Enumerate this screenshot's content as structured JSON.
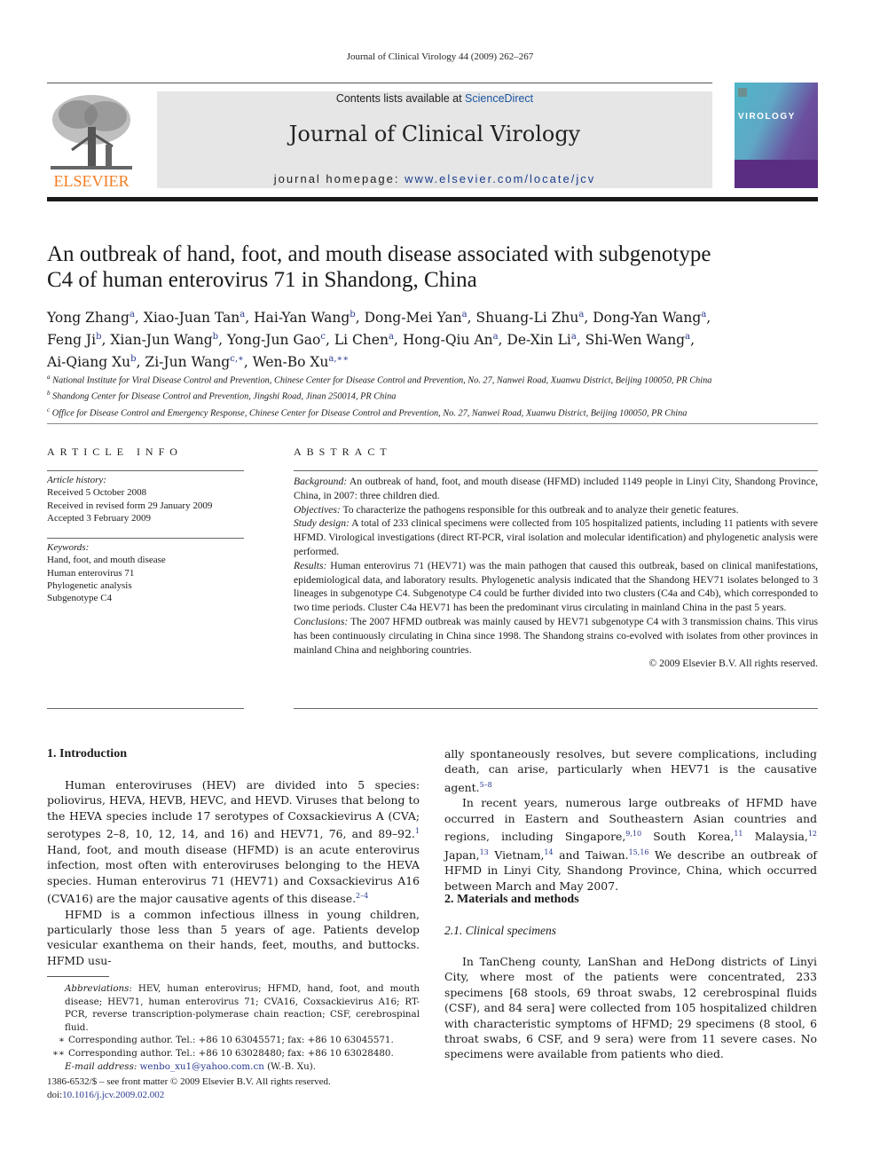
{
  "running_head": "Journal of Clinical Virology 44 (2009) 262–267",
  "masthead": {
    "contents_prefix": "Contents lists available at ",
    "contents_link": "ScienceDirect",
    "journal_title": "Journal of Clinical Virology",
    "homepage_prefix": "journal homepage: ",
    "homepage_url": "www.elsevier.com/locate/jcv",
    "publisher_logo": "ELSEVIER",
    "cover_title": "VIROLOGY",
    "icons": {
      "logo": "elsevier-tree-logo",
      "cover": "journal-cover-thumbnail"
    }
  },
  "article": {
    "title_line1": "An outbreak of hand, foot, and mouth disease associated with subgenotype",
    "title_line2": "C4 of human enterovirus 71 in Shandong, China",
    "authors": [
      {
        "name": "Yong Zhang",
        "aff": "a"
      },
      {
        "name": "Xiao-Juan Tan",
        "aff": "a"
      },
      {
        "name": "Hai-Yan Wang",
        "aff": "b"
      },
      {
        "name": "Dong-Mei Yan",
        "aff": "a"
      },
      {
        "name": "Shuang-Li Zhu",
        "aff": "a"
      },
      {
        "name": "Dong-Yan Wang",
        "aff": "a"
      },
      {
        "name": "Feng Ji",
        "aff": "b"
      },
      {
        "name": "Xian-Jun Wang",
        "aff": "b"
      },
      {
        "name": "Yong-Jun Gao",
        "aff": "c"
      },
      {
        "name": "Li Chen",
        "aff": "a"
      },
      {
        "name": "Hong-Qiu An",
        "aff": "a"
      },
      {
        "name": "De-Xin Li",
        "aff": "a"
      },
      {
        "name": "Shi-Wen Wang",
        "aff": "a"
      },
      {
        "name": "Ai-Qiang Xu",
        "aff": "b"
      },
      {
        "name": "Zi-Jun Wang",
        "aff": "c,∗"
      },
      {
        "name": "Wen-Bo Xu",
        "aff": "a,∗∗"
      }
    ],
    "affiliations": [
      {
        "key": "a",
        "text": "National Institute for Viral Disease Control and Prevention, Chinese Center for Disease Control and Prevention, No. 27, Nanwei Road, Xuanwu District, Beijing 100050, PR China"
      },
      {
        "key": "b",
        "text": "Shandong Center for Disease Control and Prevention, Jingshi Road, Jinan 250014, PR China"
      },
      {
        "key": "c",
        "text": "Office for Disease Control and Emergency Response, Chinese Center for Disease Control and Prevention, No. 27, Nanwei Road, Xuanwu District, Beijing 100050, PR China"
      }
    ]
  },
  "article_info": {
    "heading": "ARTICLE INFO",
    "history_label": "Article history:",
    "history": [
      "Received 5 October 2008",
      "Received in revised form 29 January 2009",
      "Accepted 3 February 2009"
    ],
    "keywords_label": "Keywords:",
    "keywords": [
      "Hand, foot, and mouth disease",
      "Human enterovirus 71",
      "Phylogenetic analysis",
      "Subgenotype C4"
    ]
  },
  "abstract": {
    "heading": "ABSTRACT",
    "sections": [
      {
        "label": "Background:",
        "text": " An outbreak of hand, foot, and mouth disease (HFMD) included 1149 people in Linyi City, Shandong Province, China, in 2007: three children died."
      },
      {
        "label": "Objectives:",
        "text": " To characterize the pathogens responsible for this outbreak and to analyze their genetic features."
      },
      {
        "label": "Study design:",
        "text": " A total of 233 clinical specimens were collected from 105 hospitalized patients, including 11 patients with severe HFMD. Virological investigations (direct RT-PCR, viral isolation and molecular identification) and phylogenetic analysis were performed."
      },
      {
        "label": "Results:",
        "text": " Human enterovirus 71 (HEV71) was the main pathogen that caused this outbreak, based on clinical manifestations, epidemiological data, and laboratory results. Phylogenetic analysis indicated that the Shandong HEV71 isolates belonged to 3 lineages in subgenotype C4. Subgenotype C4 could be further divided into two clusters (C4a and C4b), which corresponded to two time periods. Cluster C4a HEV71 has been the predominant virus circulating in mainland China in the past 5 years."
      },
      {
        "label": "Conclusions:",
        "text": " The 2007 HFMD outbreak was mainly caused by HEV71 subgenotype C4 with 3 transmission chains. This virus has been continuously circulating in China since 1998. The Shandong strains co-evolved with isolates from other provinces in mainland China and neighboring countries."
      }
    ],
    "copyright": "© 2009 Elsevier B.V. All rights reserved."
  },
  "body": {
    "intro_heading": "1.  Introduction",
    "intro_p1_a": "Human enteroviruses (HEV) are divided into 5 species: poliovirus, HEVA, HEVB, HEVC, and HEVD. Viruses that belong to the HEVA species include 17 serotypes of Coxsackievirus A (CVA; serotypes 2–8, 10, 12, 14, and 16) and HEV71, 76, and 89–92.",
    "intro_p1_ref1": "1",
    "intro_p1_b": " Hand, foot, and mouth disease (HFMD) is an acute enterovirus infection, most often with enteroviruses belonging to the HEVA species. Human enterovirus 71 (HEV71) and Coxsackievirus A16 (CVA16) are the major causative agents of this disease.",
    "intro_p1_ref2": "2–4",
    "intro_p2": "HFMD is a common infectious illness in young children, particularly those less than 5 years of age. Patients develop vesicular exanthema on their hands, feet, mouths, and buttocks. HFMD usu-",
    "right_p1": "ally spontaneously resolves, but severe complications, including death, can arise, particularly when HEV71 is the causative agent.",
    "right_p1_ref": "5–8",
    "right_p2_a": "In recent years, numerous large outbreaks of HFMD have occurred in Eastern and Southeastern Asian countries and regions, including Singapore,",
    "ref_sg": "9,10",
    "right_p2_b": " South Korea,",
    "ref_kr": "11",
    "right_p2_c": " Malaysia,",
    "ref_my": "12",
    "right_p2_d": " Japan,",
    "ref_jp": "13",
    "right_p2_e": " Vietnam,",
    "ref_vn": "14",
    "right_p2_f": " and Taiwan.",
    "ref_tw": "15,16",
    "right_p2_g": " We describe an outbreak of HFMD in Linyi City, Shandong Province, China, which occurred between March and May 2007.",
    "mm_heading": "2.  Materials and methods",
    "sub_heading": "2.1.  Clinical specimens",
    "specimens_p": "In TanCheng county, LanShan and HeDong districts of Linyi City, where most of the patients were concentrated, 233 specimens [68 stools, 69 throat swabs, 12 cerebrospinal fluids (CSF), and 84 sera] were collected from 105 hospitalized children with characteristic symptoms of HFMD; 29 specimens (8 stool, 6 throat swabs, 6 CSF, and 9 sera) were from 11 severe cases. No specimens were available from patients who died."
  },
  "footnotes": {
    "abbrev_label": "Abbreviations:",
    "abbrev_text": "  HEV, human enterovirus; HFMD, hand, foot, and mouth disease; HEV71, human enterovirus 71; CVA16, Coxsackievirus A16; RT-PCR, reverse transcription-polymerase chain reaction; CSF, cerebrospinal fluid.",
    "corr1_mark": "∗",
    "corr1": "Corresponding author. Tel.: +86 10 63045571; fax: +86 10 63045571.",
    "corr2_mark": "∗∗",
    "corr2": "Corresponding author. Tel.: +86 10 63028480; fax: +86 10 63028480.",
    "email_label": "E-mail address:",
    "email": "wenbo_xu1@yahoo.com.cn",
    "email_suffix": " (W.-B. Xu)."
  },
  "frontmatter": {
    "issn_line": "1386-6532/$ – see front matter © 2009 Elsevier B.V. All rights reserved.",
    "doi_prefix": "doi:",
    "doi": "10.1016/j.jcv.2009.02.002"
  }
}
